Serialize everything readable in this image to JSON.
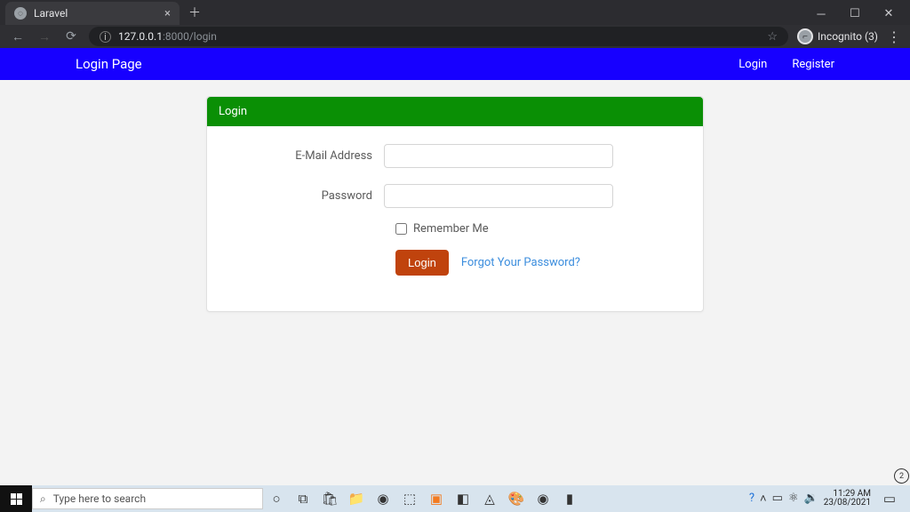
{
  "browser": {
    "tab_title": "Laravel",
    "url_host": "127.0.0.1",
    "url_port_path": ":8000/login",
    "incognito_label": "Incognito (3)"
  },
  "navbar": {
    "brand": "Login Page",
    "links": {
      "login": "Login",
      "register": "Register"
    }
  },
  "card": {
    "header": "Login",
    "email_label": "E-Mail Address",
    "password_label": "Password",
    "remember_label": "Remember Me",
    "login_button": "Login",
    "forgot_link": "Forgot Your Password?"
  },
  "taskbar": {
    "search_placeholder": "Type here to search",
    "time": "11:29 AM",
    "date": "23/08/2021",
    "scroll_count": "2"
  }
}
